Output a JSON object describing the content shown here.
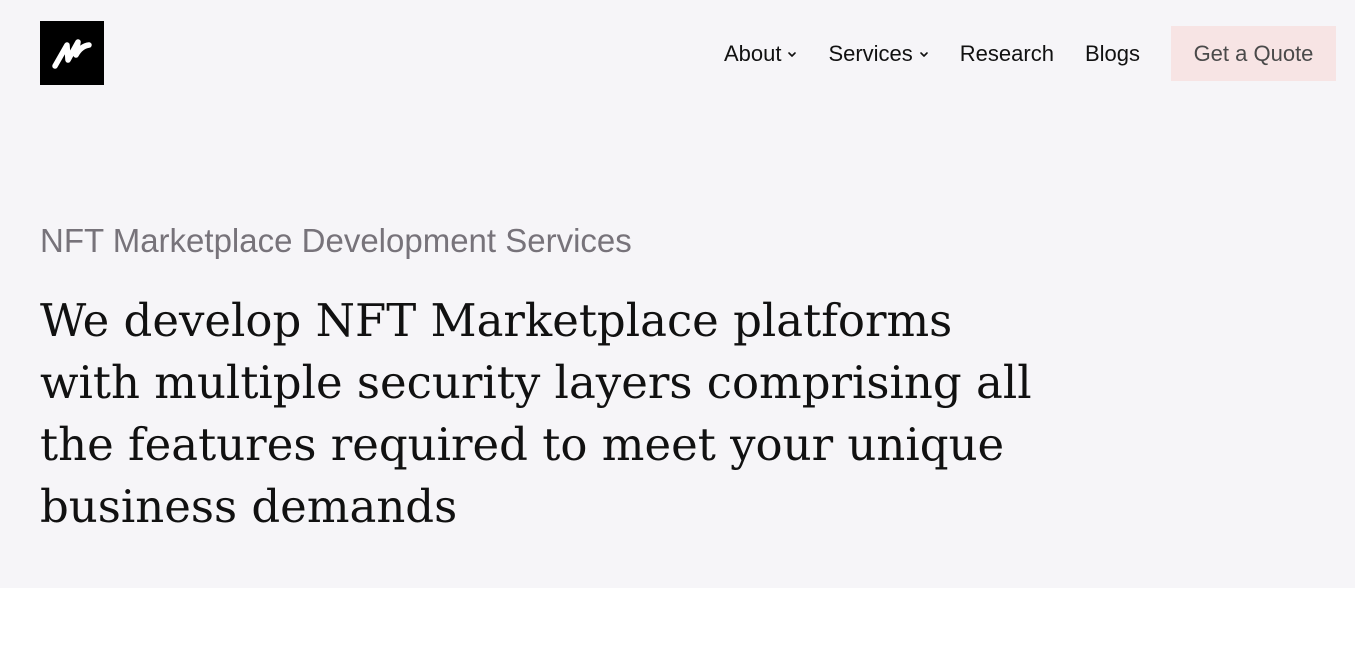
{
  "header": {
    "logo": {
      "icon": "w-logo-icon",
      "background_color": "#000000",
      "glyph_color": "#ffffff"
    },
    "nav": [
      {
        "label": "About",
        "has_dropdown": true
      },
      {
        "label": "Services",
        "has_dropdown": true
      },
      {
        "label": "Research",
        "has_dropdown": false
      },
      {
        "label": "Blogs",
        "has_dropdown": false
      }
    ],
    "cta": {
      "label": "Get a Quote",
      "background_color": "#f7e4e4"
    }
  },
  "hero": {
    "subtitle": "NFT Marketplace Development Services",
    "headline": "We develop NFT Marketplace platforms with multiple security layers comprising all the features required to meet your unique business demands",
    "background_color": "#f6f5f8"
  }
}
